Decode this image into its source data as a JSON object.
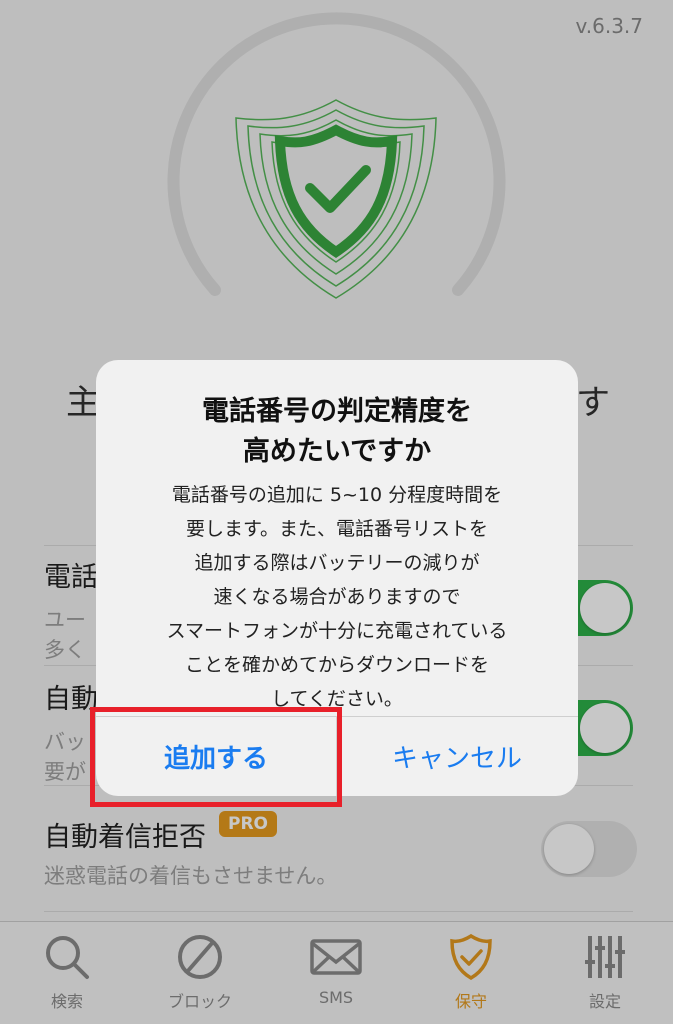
{
  "version": "v.6.3.7",
  "main": {
    "status_left": "主",
    "status_right": "す"
  },
  "settings": [
    {
      "title": "電話",
      "desc_line1": "ユー",
      "desc_line2": "多く",
      "toggle": "on"
    },
    {
      "title": "自動",
      "desc_line1": "バッ",
      "desc_line2": "要が",
      "toggle": "on"
    },
    {
      "title": "自動着信拒否",
      "badge": "PRO",
      "desc_line1": "迷惑電話の着信もさせません。",
      "toggle": "off"
    }
  ],
  "dialog": {
    "title_line1": "電話番号の判定精度を",
    "title_line2": "高めたいですか",
    "message_lines": [
      "電話番号の追加に 5~10 分程度時間を",
      "要します。また、電話番号リストを",
      "追加する際はバッテリーの減りが",
      "速くなる場合がありますので",
      "スマートフォンが十分に充電されている",
      "ことを確かめてからダウンロードを",
      "してください。"
    ],
    "confirm_label": "追加する",
    "cancel_label": "キャンセル"
  },
  "tabs": [
    {
      "label": "検索",
      "icon": "search-icon"
    },
    {
      "label": "ブロック",
      "icon": "block-icon"
    },
    {
      "label": "SMS",
      "icon": "mail-icon"
    },
    {
      "label": "保守",
      "icon": "shield-check-icon",
      "active": true
    },
    {
      "label": "設定",
      "icon": "sliders-icon"
    }
  ],
  "colors": {
    "accent_green": "#2eb34a",
    "accent_orange": "#e49a21",
    "link_blue": "#1a7cf0",
    "highlight_red": "#e8202a"
  }
}
